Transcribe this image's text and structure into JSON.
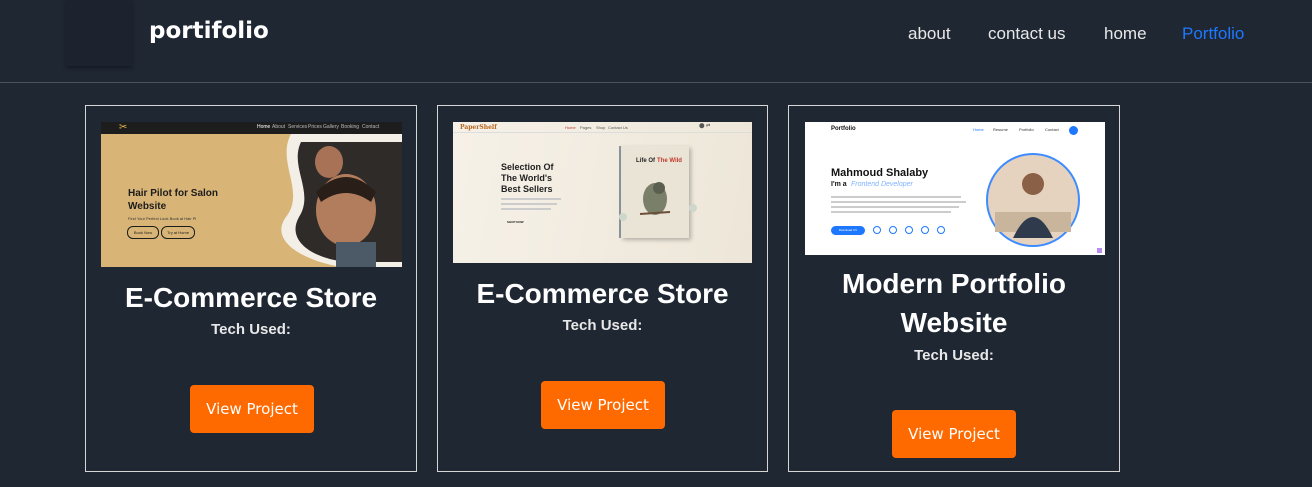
{
  "brand": "portifolio",
  "nav": [
    {
      "label": "about",
      "active": false
    },
    {
      "label": "contact us",
      "active": false
    },
    {
      "label": "home",
      "active": false
    },
    {
      "label": "Portfolio",
      "active": true
    }
  ],
  "projects": [
    {
      "title": "E-Commerce Store",
      "tech_label": "Tech Used:",
      "button": "View Project",
      "thumb": {
        "nav_items": [
          "Home",
          "About",
          "Services",
          "Prices",
          "Gallery",
          "Booking",
          "Contact"
        ],
        "headline_1": "Hair Pilot for Salon",
        "headline_2": "Website",
        "sub": "Find Your Perfect Look Book at Hair Pi",
        "btn1": "Book Now",
        "btn2": "Try at Home"
      }
    },
    {
      "title": "E-Commerce Store",
      "tech_label": "Tech Used:",
      "button": "View Project",
      "thumb": {
        "logo": "PaperShelf",
        "nav_items": [
          "Home",
          "Pages",
          "Shop",
          "Contact Us"
        ],
        "headline_1": "Selection Of",
        "headline_2": "The World's",
        "headline_3": "Best Sellers",
        "link": "SHOP NOW",
        "book_title_1": "Life Of",
        "book_title_2": "The Wild"
      }
    },
    {
      "title_line1": "Modern Portfolio",
      "title_line2": "Website",
      "tech_label": "Tech Used:",
      "button": "View Project",
      "thumb": {
        "logo": "Portfolio",
        "nav_items": [
          "Home",
          "Resume",
          "Portfolio",
          "Contact"
        ],
        "name": "Mahmoud Shalaby",
        "role_prefix": "I'm a",
        "role": "Frontend Developer",
        "cta": "Download CV"
      }
    }
  ],
  "colors": {
    "background": "#1f2733",
    "accent_button": "#ff6a00",
    "active_link": "#1e77ff"
  }
}
